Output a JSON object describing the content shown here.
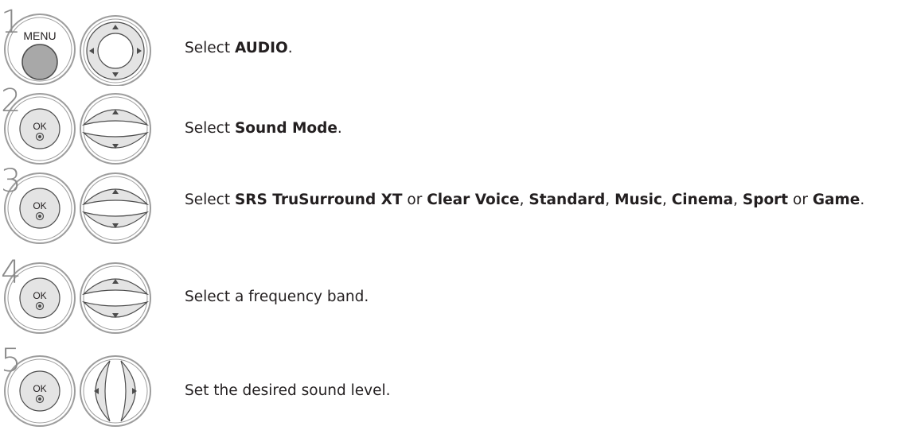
{
  "colors": {
    "ring": "#9d9d9d",
    "button_fill": "#e4e4e4",
    "menu_key": "#a8a8a8",
    "arrow": "#4d4d4d",
    "text": "#231f20"
  },
  "steps": [
    {
      "number": "1",
      "key_label": "MENU",
      "key_icon": "menu-button-icon",
      "nav_icon": "four-way-dpad-icon",
      "parts": [
        {
          "t": "Select "
        },
        {
          "b": "AUDIO"
        },
        {
          "t": "."
        }
      ]
    },
    {
      "number": "2",
      "key_label": "OK",
      "key_icon": "ok-button-icon",
      "nav_icon": "up-down-arrows-icon",
      "parts": [
        {
          "t": "Select "
        },
        {
          "b": "Sound Mode"
        },
        {
          "t": "."
        }
      ]
    },
    {
      "number": "3",
      "key_label": "OK",
      "key_icon": "ok-button-icon",
      "nav_icon": "up-down-arrows-icon",
      "parts": [
        {
          "t": "Select "
        },
        {
          "b": "SRS TruSurround XT"
        },
        {
          "t": " or "
        },
        {
          "b": "Clear Voice"
        },
        {
          "t": ", "
        },
        {
          "b": "Standard"
        },
        {
          "t": ", "
        },
        {
          "b": "Music"
        },
        {
          "t": ", "
        },
        {
          "b": "Cinema"
        },
        {
          "t": ", "
        },
        {
          "b": "Sport"
        },
        {
          "t": " or "
        },
        {
          "b": "Game"
        },
        {
          "t": "."
        }
      ]
    },
    {
      "number": "4",
      "key_label": "OK",
      "key_icon": "ok-button-icon",
      "nav_icon": "up-down-arrows-icon",
      "parts": [
        {
          "t": "Select a frequency band."
        }
      ]
    },
    {
      "number": "5",
      "key_label": "OK",
      "key_icon": "ok-button-icon",
      "nav_icon": "left-right-arrows-icon",
      "parts": [
        {
          "t": "Set the desired sound level."
        }
      ]
    }
  ]
}
